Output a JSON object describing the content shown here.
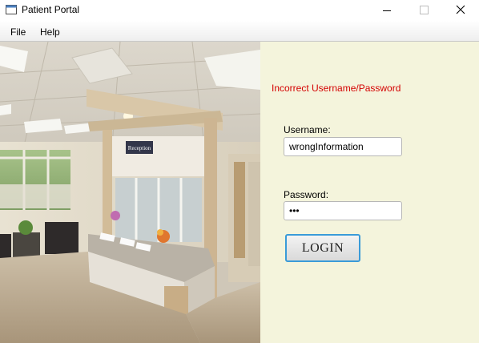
{
  "window": {
    "title": "Patient Portal",
    "icons": {
      "app": "window-app-icon",
      "minimize": "minimize-icon",
      "maximize": "maximize-icon",
      "close": "close-icon"
    }
  },
  "menu": {
    "file": "File",
    "help": "Help"
  },
  "photo": {
    "sign_text": "Reception"
  },
  "form": {
    "error": "Incorrect Username/Password",
    "username_label": "Username:",
    "username_value": "wrongInformation",
    "password_label": "Password:",
    "password_value": "abc",
    "login_label": "LOGIN"
  },
  "colors": {
    "panel_bg": "#f4f4dc",
    "error": "#d40000",
    "focus_border": "#3a9bd8"
  }
}
